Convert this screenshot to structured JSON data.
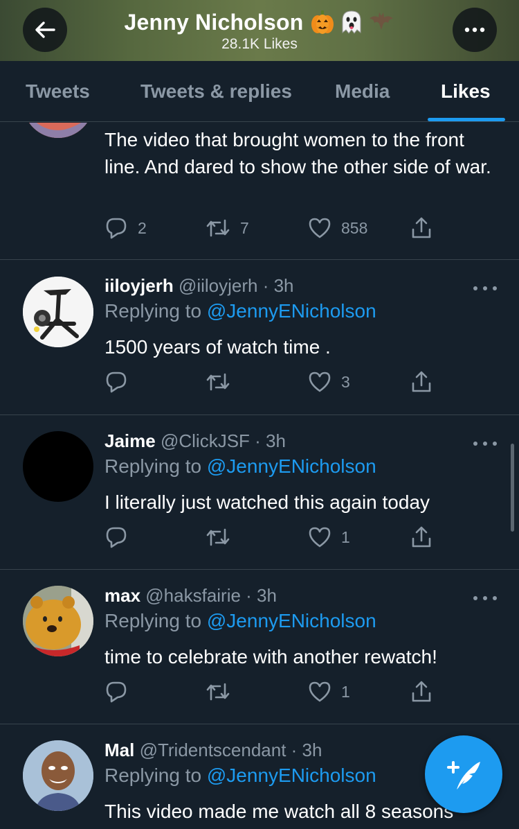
{
  "header": {
    "name": "Jenny Nicholson",
    "emoji": [
      "🎃",
      "👻",
      "🦇"
    ],
    "subtitle": "28.1K Likes",
    "gradient_colors": [
      "#3b4a33",
      "#6a7a4a"
    ]
  },
  "tabs": [
    {
      "label": "Tweets",
      "active": false
    },
    {
      "label": "Tweets & replies",
      "active": false
    },
    {
      "label": "Media",
      "active": false
    },
    {
      "label": "Likes",
      "active": true
    }
  ],
  "colors": {
    "background": "#15202b",
    "accent": "#1d9bf0",
    "muted": "#8b98a5",
    "divider": "#38444d"
  },
  "tweets": [
    {
      "text": "The video that brought women to the front line.  And dared to show the other side of war.",
      "reply_count": "2",
      "retweet_count": "7",
      "like_count": "858"
    },
    {
      "name": "iiloyjerh",
      "handle": "@iiloyjerh · 3h",
      "replying_label": "Replying to",
      "replying_to": "@JennyENicholson",
      "text": "1500 years of watch time .",
      "reply_count": "",
      "retweet_count": "",
      "like_count": "3"
    },
    {
      "name": "Jaime",
      "handle": "@ClickJSF · 3h",
      "replying_label": "Replying to",
      "replying_to": "@JennyENicholson",
      "text": "I literally just watched this again today",
      "reply_count": "",
      "retweet_count": "",
      "like_count": "1"
    },
    {
      "name": "max",
      "handle": "@haksfairie · 3h",
      "replying_label": "Replying to",
      "replying_to": "@JennyENicholson",
      "text": "time to celebrate with another rewatch!",
      "reply_count": "",
      "retweet_count": "",
      "like_count": "1"
    },
    {
      "name": "Mal",
      "handle": "@Tridentscendant · 3h",
      "replying_label": "Replying to",
      "replying_to": "@JennyENicholson",
      "text": "This video made me watch all 8 seasons"
    }
  ],
  "icons": {
    "back": "arrow-left-icon",
    "more": "more-icon",
    "reply": "reply-icon",
    "retweet": "retweet-icon",
    "like": "heart-icon",
    "share": "share-icon",
    "compose": "compose-tweet-icon"
  }
}
